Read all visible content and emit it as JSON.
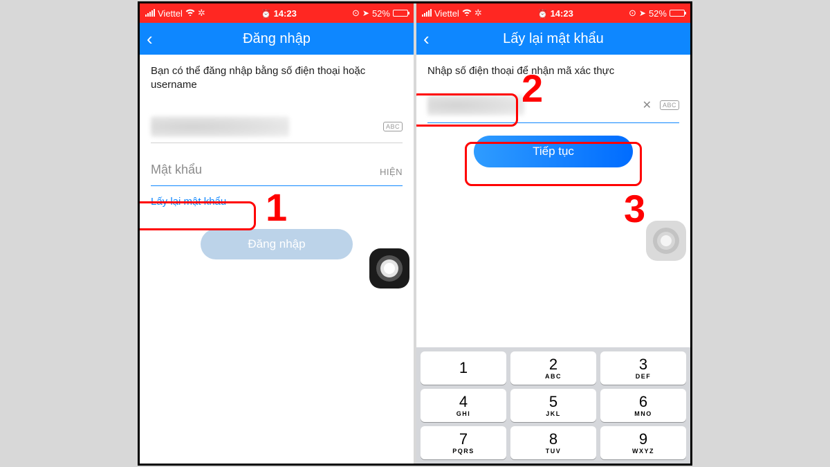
{
  "status_bar": {
    "carrier": "Viettel",
    "time": "14:23",
    "battery_percent": "52%"
  },
  "screens": {
    "left": {
      "title": "Đăng nhập",
      "instruction": "Bạn có thể đăng nhập bằng số điện thoại hoặc username",
      "abc_badge": "ABC",
      "password_placeholder": "Mật khẩu",
      "show_label": "HIỆN",
      "forgot_link": "Lấy lại mật khẩu",
      "login_button": "Đăng nhập"
    },
    "right": {
      "title": "Lấy lại mật khẩu",
      "instruction": "Nhập số điện thoại để nhận mã xác thực",
      "abc_badge": "ABC",
      "continue_button": "Tiếp tục"
    }
  },
  "annotations": {
    "step1": "1",
    "step2": "2",
    "step3": "3"
  },
  "keypad": [
    {
      "digit": "1",
      "letters": ""
    },
    {
      "digit": "2",
      "letters": "ABC"
    },
    {
      "digit": "3",
      "letters": "DEF"
    },
    {
      "digit": "4",
      "letters": "GHI"
    },
    {
      "digit": "5",
      "letters": "JKL"
    },
    {
      "digit": "6",
      "letters": "MNO"
    },
    {
      "digit": "7",
      "letters": "PQRS"
    },
    {
      "digit": "8",
      "letters": "TUV"
    },
    {
      "digit": "9",
      "letters": "WXYZ"
    }
  ]
}
